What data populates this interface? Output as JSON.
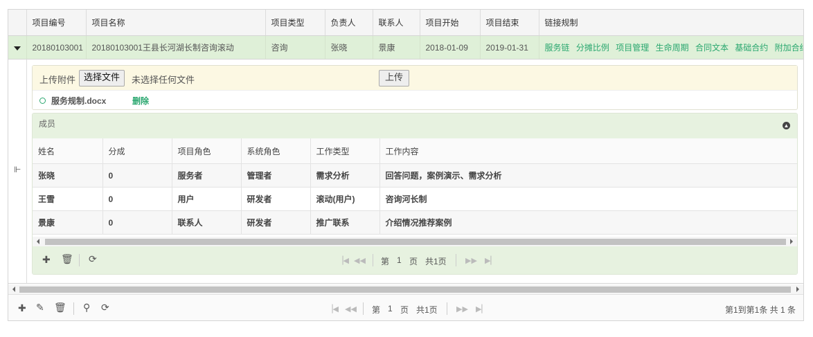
{
  "grid": {
    "headers": [
      "项目编号",
      "项目名称",
      "项目类型",
      "负责人",
      "联系人",
      "项目开始",
      "项目结束",
      "链接规制"
    ],
    "row": {
      "code": "20180103001",
      "name": "20180103001王县长河湖长制咨询滚动",
      "type": "咨询",
      "owner": "张晓",
      "contact": "景康",
      "start": "2018-01-09",
      "end": "2019-01-31",
      "links": [
        "服务链",
        "分摊比例",
        "项目管理",
        "生命周期",
        "合同文本",
        "基础合约",
        "附加合约"
      ]
    }
  },
  "upload": {
    "label": "上传附件",
    "choose_button": "选择文件",
    "no_file": "未选择任何文件",
    "upload_button": "上传",
    "file_name": "服务规制.docx",
    "delete_label": "删除"
  },
  "members": {
    "title": "成员",
    "headers": [
      "姓名",
      "分成",
      "项目角色",
      "系统角色",
      "工作类型",
      "工作内容"
    ],
    "rows": [
      [
        "张晓",
        "0",
        "服务者",
        "管理者",
        "需求分析",
        "回答问题，案例演示、需求分析"
      ],
      [
        "王雪",
        "0",
        "用户",
        "研发者",
        "滚动(用户)",
        "咨询河长制"
      ],
      [
        "景康",
        "0",
        "联系人",
        "研发者",
        "推广联系",
        "介绍情况推荐案例"
      ]
    ],
    "pager": {
      "prefix": "第",
      "page": "1",
      "suffix": "页",
      "total": "共1页"
    }
  },
  "footer": {
    "pager": {
      "prefix": "第",
      "page": "1",
      "suffix": "页",
      "total": "共1页"
    },
    "record_info": "第1到第1条  共 1 条"
  },
  "icons": {
    "add": "add-icon",
    "edit": "edit-icon",
    "delete": "trash-icon",
    "search": "search-icon",
    "refresh": "refresh-icon",
    "expand": "caret-down-icon",
    "collapse": "collapse-up-icon"
  },
  "colors": {
    "accent": "#2aa76f",
    "row_highlight": "#dff0d8",
    "upload_bg": "#fcf8e3",
    "panel_green": "#e7f2e0"
  }
}
